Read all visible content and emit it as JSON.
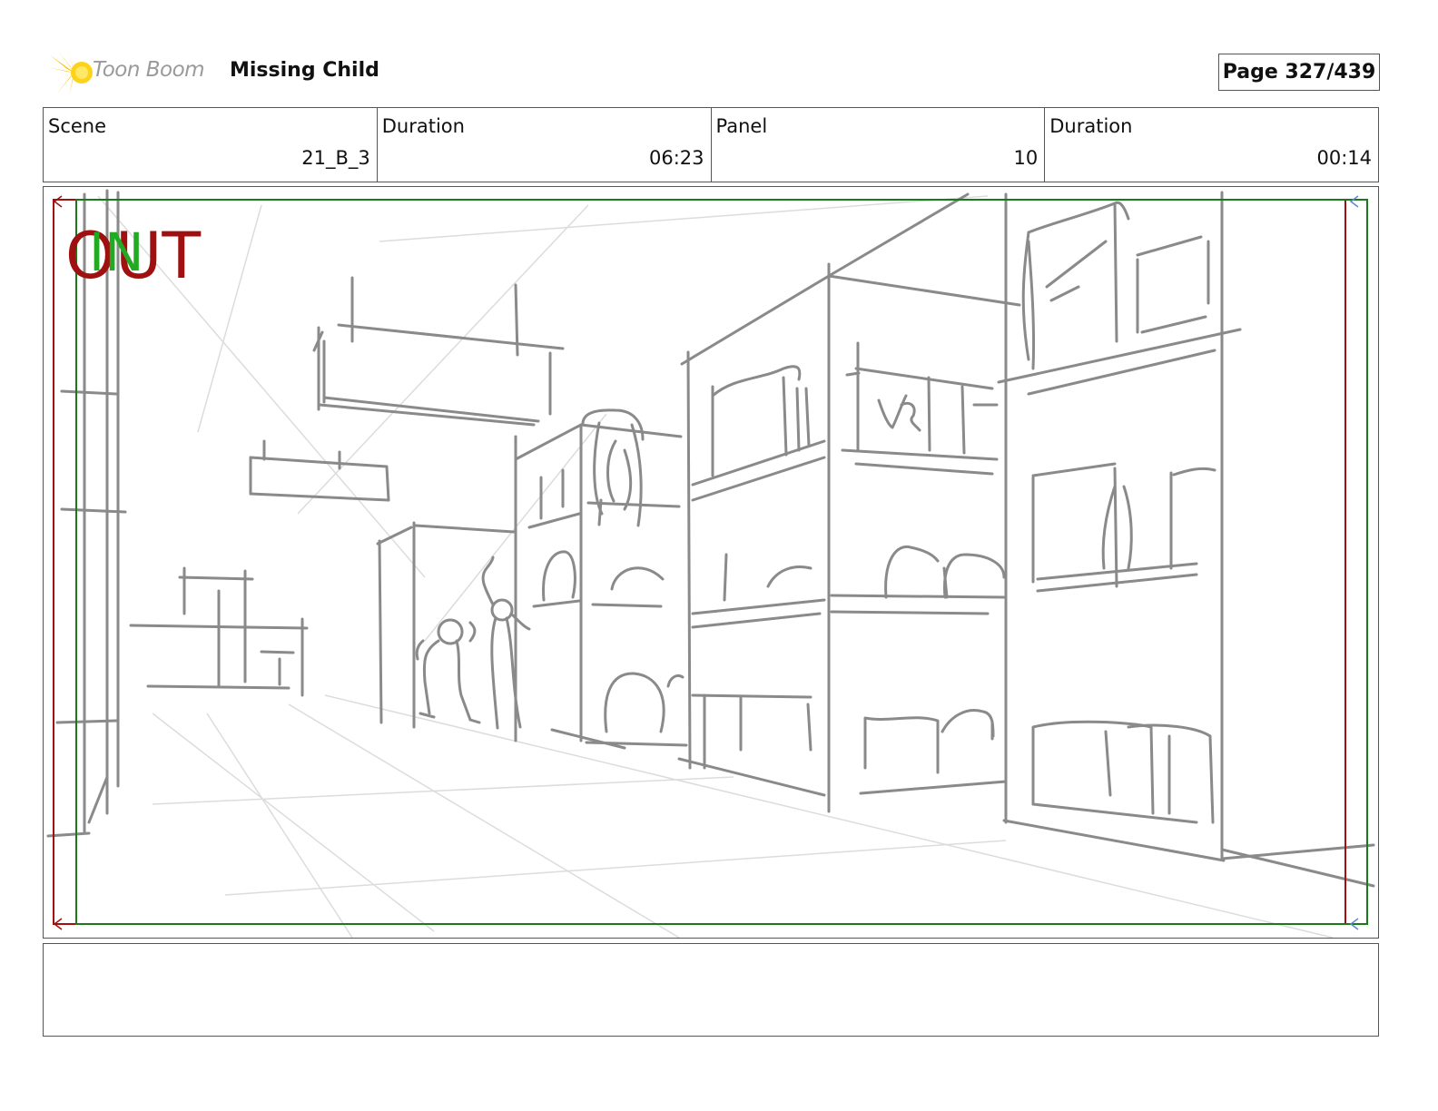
{
  "header": {
    "logo_text": "Toon Boom",
    "title": "Missing Child",
    "page": "Page 327/439"
  },
  "info": {
    "scene_label": "Scene",
    "scene_value": "21_B_3",
    "duration_label": "Duration",
    "duration_value": "06:23",
    "panel_label": "Panel",
    "panel_value": "10",
    "panel_duration_label": "Duration",
    "panel_duration_value": "00:14"
  },
  "panel": {
    "out_label": "OUT",
    "in_label": "IN"
  },
  "caption": {
    "text": ""
  },
  "colors": {
    "out_frame": "#a01010",
    "in_frame": "#1a7a1a",
    "sketch": "#8a8a8a",
    "logo": "#f5c400"
  }
}
